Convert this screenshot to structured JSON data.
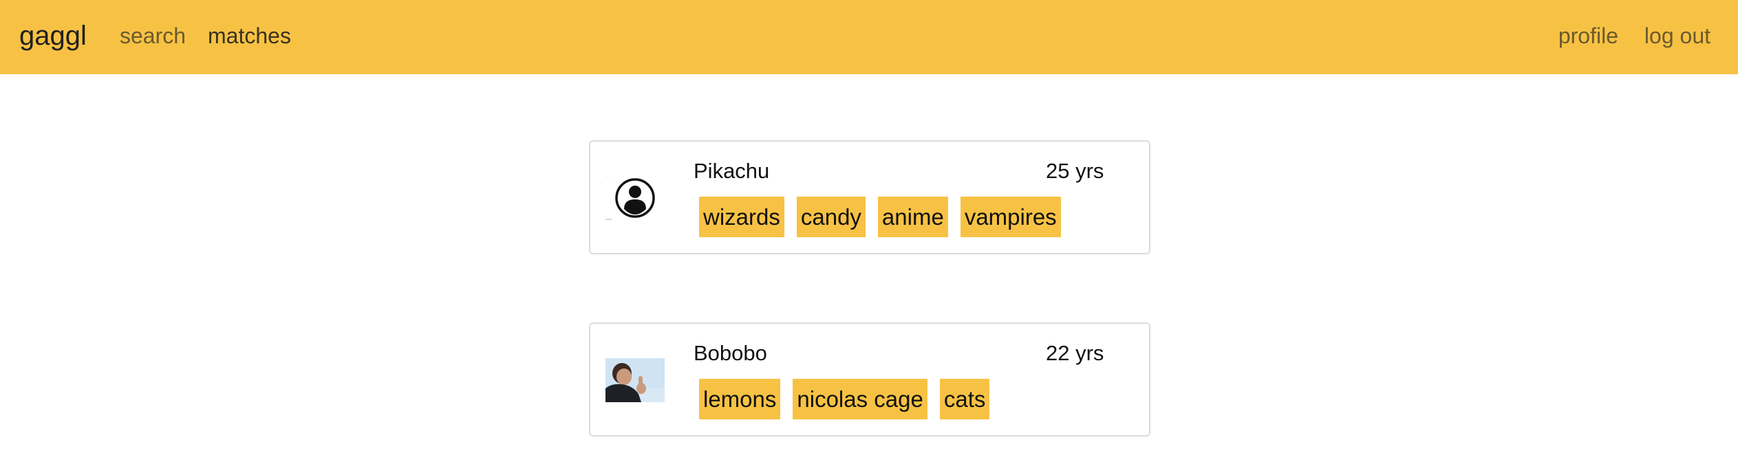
{
  "navbar": {
    "brand": "gaggl",
    "search_label": "search",
    "matches_label": "matches",
    "profile_label": "profile",
    "logout_label": "log out",
    "background_color": "#f7c244"
  },
  "matches": [
    {
      "name": "Pikachu",
      "age": "25 yrs",
      "avatar_icon": "user-placeholder-icon",
      "tags": [
        "wizards",
        "candy",
        "anime",
        "vampires"
      ]
    },
    {
      "name": "Bobobo",
      "age": "22 yrs",
      "avatar_icon": "profile-photo",
      "tags": [
        "lemons",
        "nicolas cage",
        "cats"
      ]
    }
  ],
  "colors": {
    "accent": "#f7c244",
    "card_border": "#dcdcdc"
  }
}
